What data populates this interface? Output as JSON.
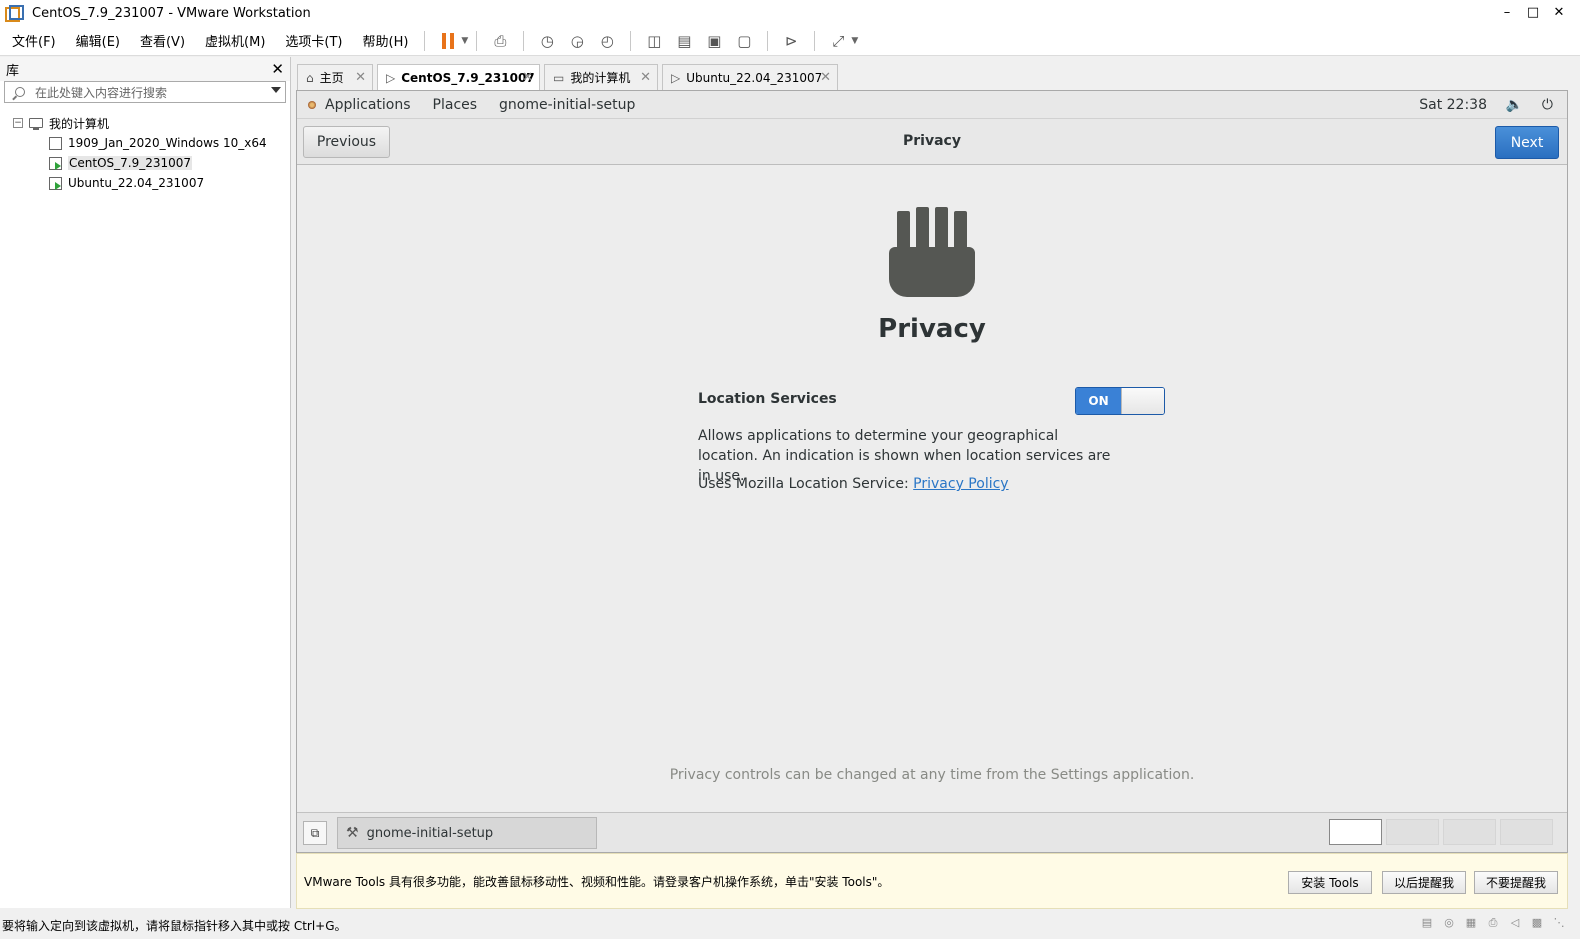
{
  "window": {
    "title": "CentOS_7.9_231007 - VMware Workstation"
  },
  "menu": [
    "文件(F)",
    "编辑(E)",
    "查看(V)",
    "虚拟机(M)",
    "选项卡(T)",
    "帮助(H)"
  ],
  "library": {
    "title": "库",
    "search_placeholder": "在此处键入内容进行搜索",
    "root": "我的计算机",
    "vms": [
      "1909_Jan_2020_Windows 10_x64",
      "CentOS_7.9_231007",
      "Ubuntu_22.04_231007"
    ]
  },
  "tabs": [
    "主页",
    "CentOS_7.9_231007",
    "我的计算机",
    "Ubuntu_22.04_231007"
  ],
  "gnome": {
    "applications": "Applications",
    "places": "Places",
    "window_name": "gnome-initial-setup",
    "clock": "Sat 22:38"
  },
  "setup": {
    "previous": "Previous",
    "header_title": "Privacy",
    "next": "Next",
    "heading": "Privacy",
    "location_label": "Location Services",
    "toggle_state": "ON",
    "description": "Allows applications to determine your geographical location. An indication is shown when location services are in use.",
    "mozilla_prefix": "Uses Mozilla Location Service:",
    "privacy_policy": "Privacy Policy",
    "footer": "Privacy controls can be changed at any time from the Settings application."
  },
  "taskbar": {
    "task": "gnome-initial-setup"
  },
  "notification": {
    "message": "VMware Tools 具有很多功能，能改善鼠标移动性、视频和性能。请登录客户机操作系统，单击\"安装 Tools\"。",
    "install": "安装 Tools",
    "remind_later": "以后提醒我",
    "never_remind": "不要提醒我"
  },
  "status": {
    "text": "要将输入定向到该虚拟机，请将鼠标指针移入其中或按 Ctrl+G。"
  },
  "colors": {
    "accent": "#3a81d6",
    "pause": "#e8731a"
  }
}
